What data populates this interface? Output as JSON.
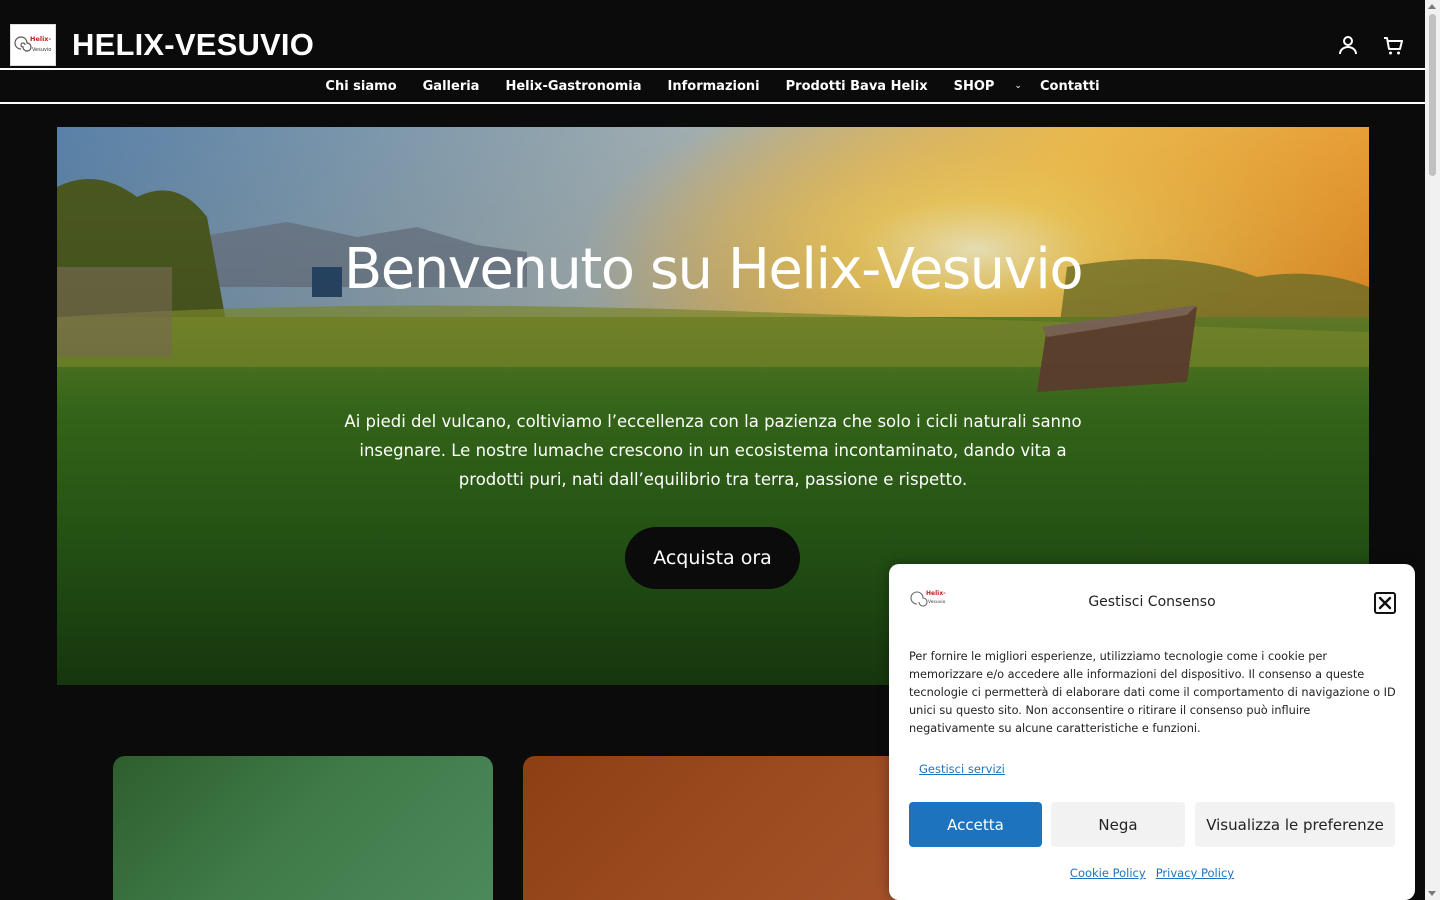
{
  "header": {
    "site_title": "HELIX-VESUVIO",
    "logo_text_top": "Helix-",
    "logo_text_bottom": "Vesuvio",
    "account_icon": "user-icon",
    "cart_icon": "cart-icon"
  },
  "nav": {
    "items": [
      {
        "label": "Chi siamo"
      },
      {
        "label": "Galleria"
      },
      {
        "label": "Helix-Gastronomia"
      },
      {
        "label": "Informazioni"
      },
      {
        "label": "Prodotti Bava Helix"
      },
      {
        "label": "SHOP",
        "has_submenu": true
      },
      {
        "label": "Contatti"
      }
    ],
    "caret": "⌄"
  },
  "hero": {
    "title": "Benvenuto su Helix-Vesuvio",
    "text": "Ai piedi del vulcano, coltiviamo l’eccellenza con la pazienza che solo i cicli naturali sanno insegnare. Le nostre lumache crescono in un ecosistema incontaminato, dando vita a prodotti puri, nati dall’equilibrio tra terra, passione e rispetto.",
    "cta": "Acquista ora"
  },
  "cookie_dialog": {
    "title": "Gestisci Consenso",
    "body": "Per fornire le migliori esperienze, utilizziamo tecnologie come i cookie per memorizzare e/o accedere alle informazioni del dispositivo. Il consenso a queste tecnologie ci permetterà di elaborare dati come il comportamento di navigazione o ID unici su questo sito. Non acconsentire o ritirare il consenso può influire negativamente su alcune caratteristiche e funzioni.",
    "manage_services": "Gestisci servizi",
    "accept": "Accetta",
    "deny": "Nega",
    "preferences": "Visualizza le preferenze",
    "cookie_policy": "Cookie Policy",
    "privacy_policy": "Privacy Policy"
  },
  "colors": {
    "background": "#0b0b0b",
    "accent_blue": "#1e73be",
    "card_green": "#3f7a48",
    "card_orange": "#9b4a1f"
  }
}
